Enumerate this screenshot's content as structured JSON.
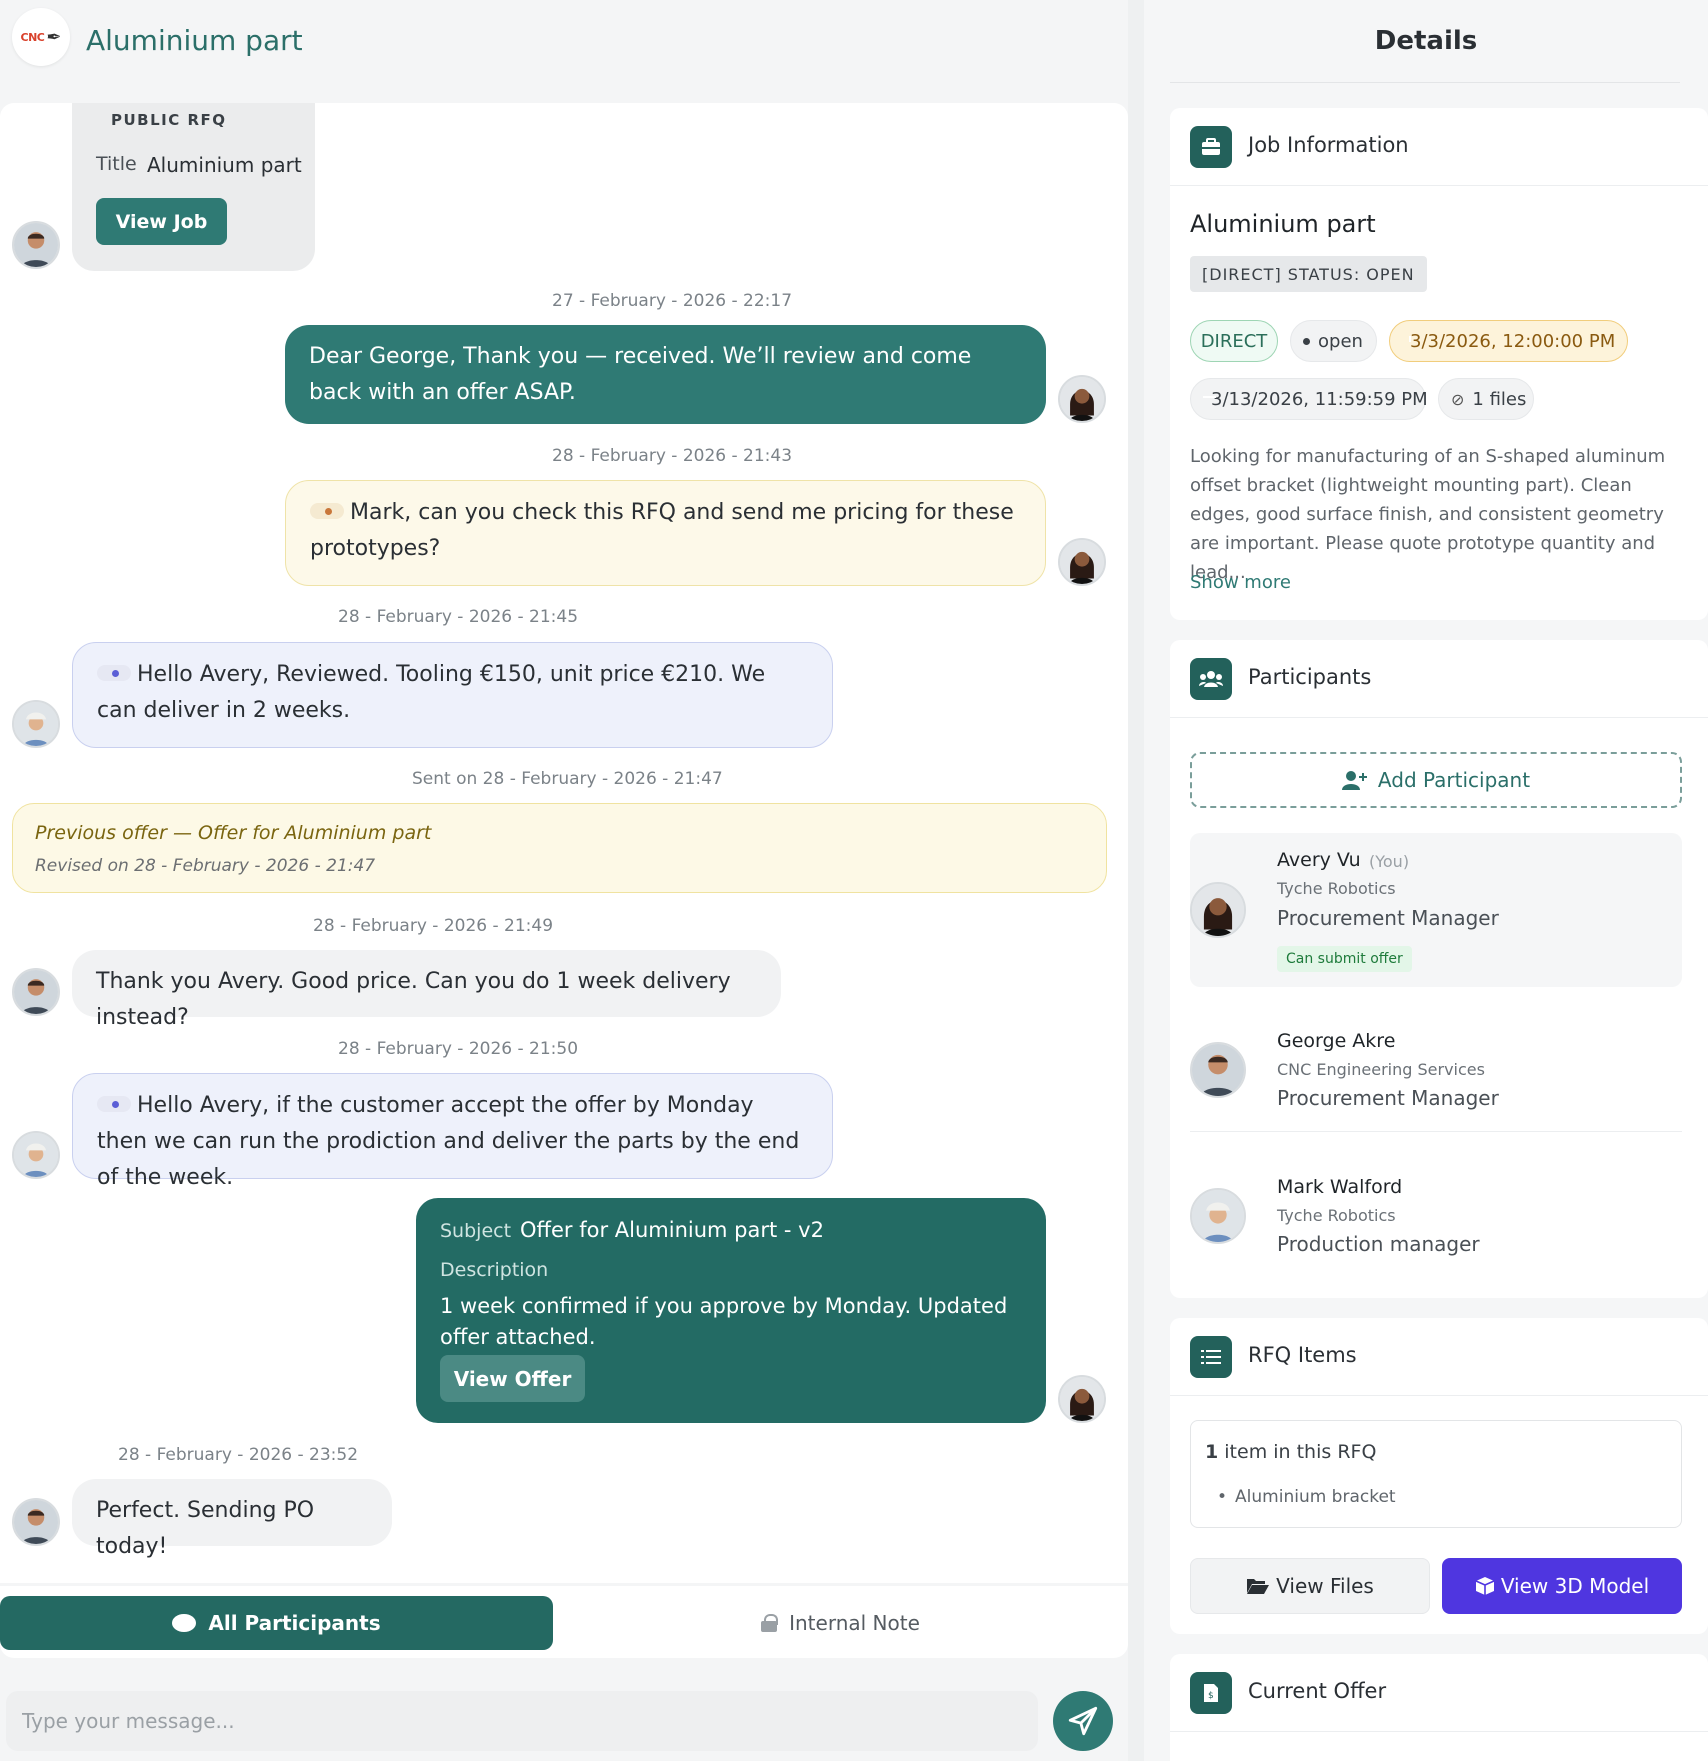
{
  "chat": {
    "title": "Aluminium part",
    "logo_text": "CNC",
    "job_card": {
      "kicker": "PUBLIC RFQ",
      "title_label": "Title",
      "title_value": "Aluminium part",
      "button": "View Job"
    },
    "messages": [
      {
        "timestamp": "27 - February - 2026 - 22:17",
        "text": "Dear George, Thank you — received. We’ll review and come back with an offer ASAP."
      },
      {
        "timestamp": "28 - February - 2026 - 21:43",
        "text": "Mark, can you check this RFQ and send me pricing for these prototypes?"
      },
      {
        "timestamp": "28 - February - 2026 - 21:45",
        "text": "Hello Avery, Reviewed. Tooling €150, unit price €210. We can deliver in 2 weeks."
      },
      {
        "timestamp": "Sent on 28 - February - 2026 - 21:47"
      },
      {
        "timestamp": "28 - February - 2026 - 21:49",
        "text": "Thank you Avery. Good price. Can you do 1 week delivery instead?"
      },
      {
        "timestamp": "28 - February - 2026 - 21:50",
        "text": "Hello Avery, if the customer accept the offer by Monday then we can run the prodiction and deliver the parts by the end of the week."
      },
      {
        "timestamp": "28 - February - 2026 - 23:52",
        "text": "Perfect. Sending PO today!"
      }
    ],
    "previous_offer": {
      "title": "Previous offer — Offer for Aluminium part",
      "revised": "Revised on 28 - February - 2026 - 21:47"
    },
    "offer_card": {
      "subject_label": "Subject",
      "subject_value": "Offer for Aluminium part - v2",
      "description_label": "Description",
      "description_value": "1 week confirmed if you approve by Monday. Updated offer attached.",
      "button": "View Offer"
    },
    "audience_tabs": {
      "all": "All Participants",
      "note": "Internal Note"
    },
    "composer": {
      "placeholder": "Type your message..."
    }
  },
  "details": {
    "title": "Details",
    "job": {
      "heading": "Job Information",
      "name": "Aluminium part",
      "status": "[DIRECT] STATUS: OPEN",
      "type_pill": "DIRECT",
      "state_pill": "open",
      "deadline": "3/3/2026, 12:00:00 PM",
      "end_date": "3/13/2026, 11:59:59 PM",
      "files": "1 files",
      "description": "Looking for manufacturing of an S-shaped aluminum offset bracket (lightweight mounting part). Clean edges, good surface finish, and consistent geometry are important. Please quote prototype quantity and lead...",
      "show_more": "Show more"
    },
    "participants": {
      "heading": "Participants",
      "add": "Add Participant",
      "people": [
        {
          "name": "Avery Vu",
          "you": "(You)",
          "company": "Tyche Robotics",
          "role": "Procurement Manager",
          "badge": "Can submit offer"
        },
        {
          "name": "George Akre",
          "company": "CNC Engineering Services",
          "role": "Procurement Manager"
        },
        {
          "name": "Mark Walford",
          "company": "Tyche Robotics",
          "role": "Production manager"
        }
      ]
    },
    "rfq_items": {
      "heading": "RFQ Items",
      "count_num": "1",
      "count_text": "item in this RFQ",
      "items": [
        "Aluminium bracket"
      ],
      "view_files": "View Files",
      "view_3d": "View 3D Model"
    },
    "current_offer": {
      "heading": "Current Offer"
    }
  }
}
